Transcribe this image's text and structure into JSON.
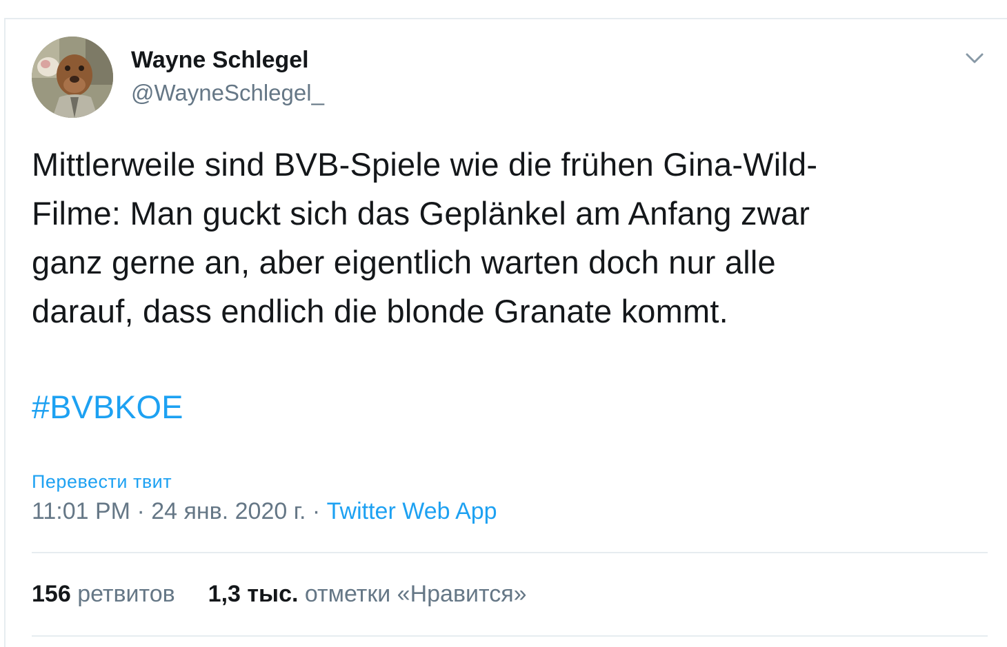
{
  "tweet": {
    "author": {
      "name": "Wayne Schlegel",
      "handle": "@WayneSchlegel_",
      "avatar_icon": "avatar-photo"
    },
    "text_lines": [
      "Mittlerweile sind BVB-Spiele wie die frühen Gina-Wild-",
      "Filme: Man guckt sich das Geplänkel am Anfang zwar",
      "ganz gerne an, aber eigentlich warten doch nur alle",
      "darauf, dass endlich die blonde Granate kommt."
    ],
    "hashtag": "#BVBKOE",
    "translate_label": "Перевести твит",
    "meta": {
      "time": "11:01 PM",
      "separator": " · ",
      "date": "24 янв. 2020 г.",
      "source": "Twitter Web App"
    },
    "stats": {
      "retweets_count": "156",
      "retweets_label": "ретвитов",
      "likes_count": "1,3 тыс.",
      "likes_label": "отметки «Нравится»"
    },
    "menu_icon": "chevron-down-icon"
  },
  "colors": {
    "text": "#14171a",
    "secondary": "#657786",
    "link": "#1da1f2",
    "divider": "#e6ecf0"
  }
}
